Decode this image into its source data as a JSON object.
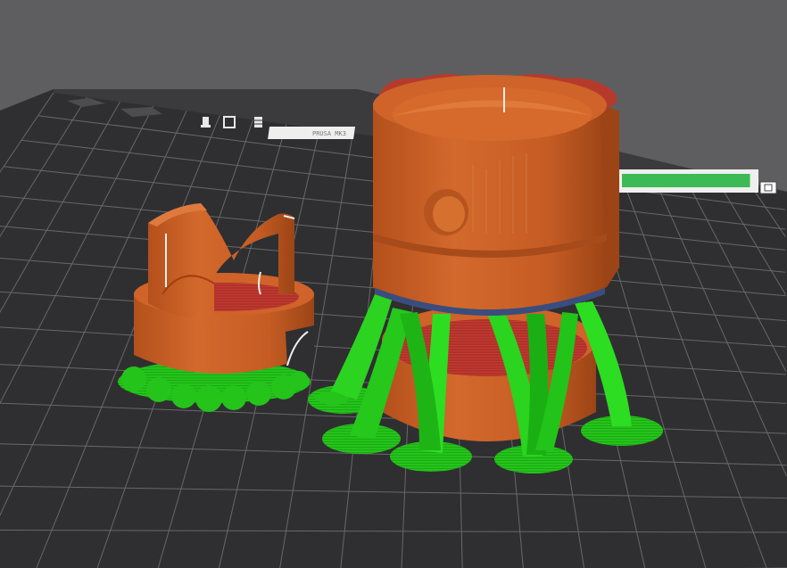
{
  "viewport": {
    "background_color": "#5e5e60",
    "bed_color": "#2f2f31",
    "grid_color": "#6c6c6f",
    "bed_label_text": "PRUSA MK3"
  },
  "bed_toolbar": {
    "icons": [
      "printer-head-icon",
      "square-icon",
      "filament-spool-icon"
    ]
  },
  "print_progress": {
    "fill_color": "#3cba56",
    "fraction": 0.97
  },
  "objects": [
    {
      "name": "short-cup-part",
      "color": "#c95f26",
      "support_color": "#22c81a"
    },
    {
      "name": "tall-cylinder-part",
      "color": "#c95f26",
      "support_color": "#22c81a"
    }
  ]
}
